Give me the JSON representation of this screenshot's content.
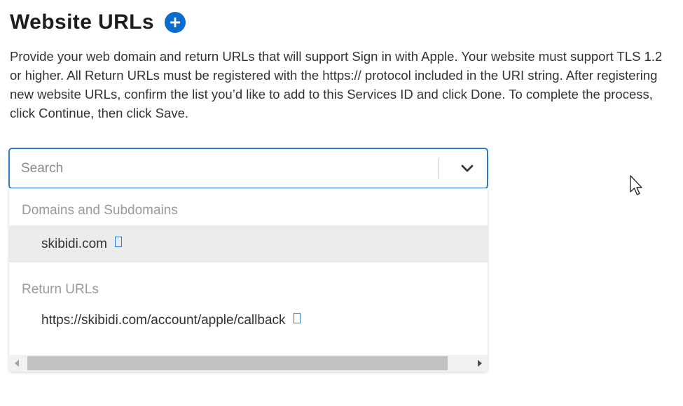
{
  "section": {
    "title": "Website URLs",
    "add_icon": "plus-circle-icon",
    "description": "Provide your web domain and return URLs that will support Sign in with Apple. Your website must support TLS 1.2 or higher. All Return URLs must be registered with the https:// protocol included in the URI string. After registering new website URLs, confirm the list you’d like to add to this Services ID and click Done. To complete the process, click Continue, then click Save."
  },
  "combobox": {
    "placeholder": "Search",
    "value": "",
    "toggle_icon": "chevron-down-icon"
  },
  "dropdown": {
    "groups": [
      {
        "label": "Domains and Subdomains",
        "options": [
          {
            "text": "skibidi.com",
            "highlighted": true
          }
        ]
      },
      {
        "label": "Return URLs",
        "options": [
          {
            "text": "https://skibidi.com/account/apple/callback",
            "highlighted": false
          }
        ]
      }
    ],
    "scrollbar": {
      "left_icon": "triangle-left-icon",
      "right_icon": "triangle-right-icon",
      "scroll_position": 0
    }
  },
  "colors": {
    "accent": "#0a6ccf",
    "focus_border": "#2f7ad1",
    "highlight_bg": "#ececec",
    "group_label": "#9a9a9e"
  },
  "cursor": {
    "icon": "mouse-pointer-icon"
  }
}
